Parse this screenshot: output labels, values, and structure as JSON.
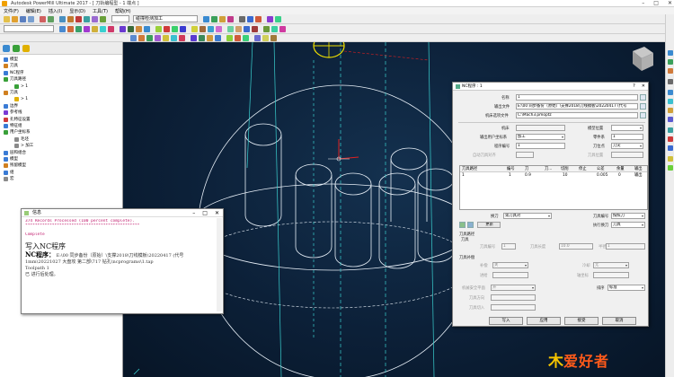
{
  "window": {
    "title": "Autodesk PowerMill Ultimate 2017 - [ 刀轨编程型 - 1 端点 ]"
  },
  "menu": [
    "文件(F)",
    "编辑(E)",
    "插入(I)",
    "显示(D)",
    "工具(T)",
    "帮助(H)"
  ],
  "toolbar": {
    "combo_left": "",
    "combo_right": "碰撞检测加工"
  },
  "tree": [
    {
      "label": "模型",
      "color": "#3a7bd5",
      "indent": 0
    },
    {
      "label": "刀具",
      "color": "#d08020",
      "indent": 0
    },
    {
      "label": "NC程序",
      "color": "#3a7bd5",
      "indent": 0
    },
    {
      "label": "刀具路径",
      "color": "#39a039",
      "indent": 0
    },
    {
      "label": "> 1",
      "color": "#39a039",
      "indent": 2
    },
    {
      "label": "刀具",
      "color": "#d08020",
      "indent": 0
    },
    {
      "label": "> 1",
      "color": "#e0b000",
      "indent": 2
    },
    {
      "label": "边界",
      "color": "#3a7bd5",
      "indent": 0
    },
    {
      "label": "参考线",
      "color": "#7a3ad5",
      "indent": 0
    },
    {
      "label": "孔特征设置",
      "color": "#d03a3a",
      "indent": 0
    },
    {
      "label": "特征组",
      "color": "#3a7bd5",
      "indent": 0
    },
    {
      "label": "用户坐标系",
      "color": "#39a039",
      "indent": 0
    },
    {
      "label": "毛坯",
      "color": "#8a8a8a",
      "indent": 2
    },
    {
      "label": "> 加工",
      "color": "#8a8a8a",
      "indent": 2
    },
    {
      "label": "层和组合",
      "color": "#3a7bd5",
      "indent": 0
    },
    {
      "label": "模型",
      "color": "#3a7bd5",
      "indent": 0
    },
    {
      "label": "残留模型",
      "color": "#d08020",
      "indent": 0
    },
    {
      "label": "组",
      "color": "#3a7bd5",
      "indent": 0
    },
    {
      "label": "宏",
      "color": "#8a8a8a",
      "indent": 0
    }
  ],
  "info_window": {
    "title": "信息",
    "lines": [
      "374 Records Processed (100 percent complete).",
      "***********************************************",
      "",
      "Complete"
    ],
    "heading": "写入NC程序",
    "nc_label": "NC程序：",
    "nc_path": "E:\\00 同步备份（原始）\\支撑2018\\刀线模板\\20220417 (代号 1mm\\20221027 大盘攻 第二部\\717 钻孔\\ncprograms\\1.tap",
    "toolpath_line": "Toolpath 1",
    "done_line": "已 进行后处理。"
  },
  "nc_dialog": {
    "title": "NC程序 : 1",
    "name_label": "名称",
    "name_value": "1",
    "output_file_label": "输出文件",
    "output_file_value": "E:\\00 同步备份（原始）\\支撑2018\\刀线模板\\20220417 (代号",
    "machine_file_label": "机床选项文件",
    "machine_file_value": "C:\\Mach3.pmoptz",
    "machine_label": "机床",
    "model_pos_label": "模型位置",
    "output_ws_label": "输出用户坐标系",
    "output_ws_value": "加工",
    "coord_label": "零件系",
    "coord_value": "1",
    "prog_num_label": "程序编号",
    "prog_num_value": "1",
    "tool_value_label": "刀位点",
    "tool_value_value": "刀尖",
    "auto_tool_label": "自动刀具对齐",
    "stock_label": "刀具位置",
    "table_headers": [
      "刀具路径",
      "编号",
      "刀",
      "刀...",
      "切削",
      "停止",
      "公差",
      "余量",
      "输出"
    ],
    "table_row": [
      "1",
      "1",
      "0.9",
      "",
      "10",
      "",
      "0.005",
      "0",
      "输出"
    ],
    "change_label": "换刀",
    "change_value": "第刀具对",
    "tool_num_label": "刀具编号",
    "tool_num_value": "按照刀",
    "exec_change_label": "执行换刀",
    "exec_change_value": "刀具",
    "update_btn": "更新",
    "toolpath_section": "刀具路径",
    "tool_section": "刀具",
    "tool_num_small_label": "刀具编号",
    "tool_num_small_value": "1",
    "len_label": "刀具长度",
    "len_value": "10.0",
    "radius_label": "半径",
    "radius_value": "1",
    "comp_section": "刀具补偿",
    "comp_label": "补偿",
    "comp_value": "关",
    "coolant_label": "冷却",
    "coolant_value": "无",
    "feed_label": "进给",
    "pos_label": "轴坐标",
    "retract_label": "机械安全平面",
    "retract_value": "开",
    "output_order_label": "排序",
    "output_order_value": "标准",
    "dir_label": "刀具方向",
    "safe_label": "刀具切入",
    "buttons": [
      "写入",
      "应用",
      "接受",
      "取消"
    ]
  },
  "watermark": {
    "mark": "木",
    "text": "爱好者"
  },
  "colors": {
    "viewport_bg": "#0c2038",
    "wire": "#e8f0f8",
    "cyan": "#3ad0d0",
    "accent_yellow": "#f0e000",
    "red": "#e02020"
  }
}
